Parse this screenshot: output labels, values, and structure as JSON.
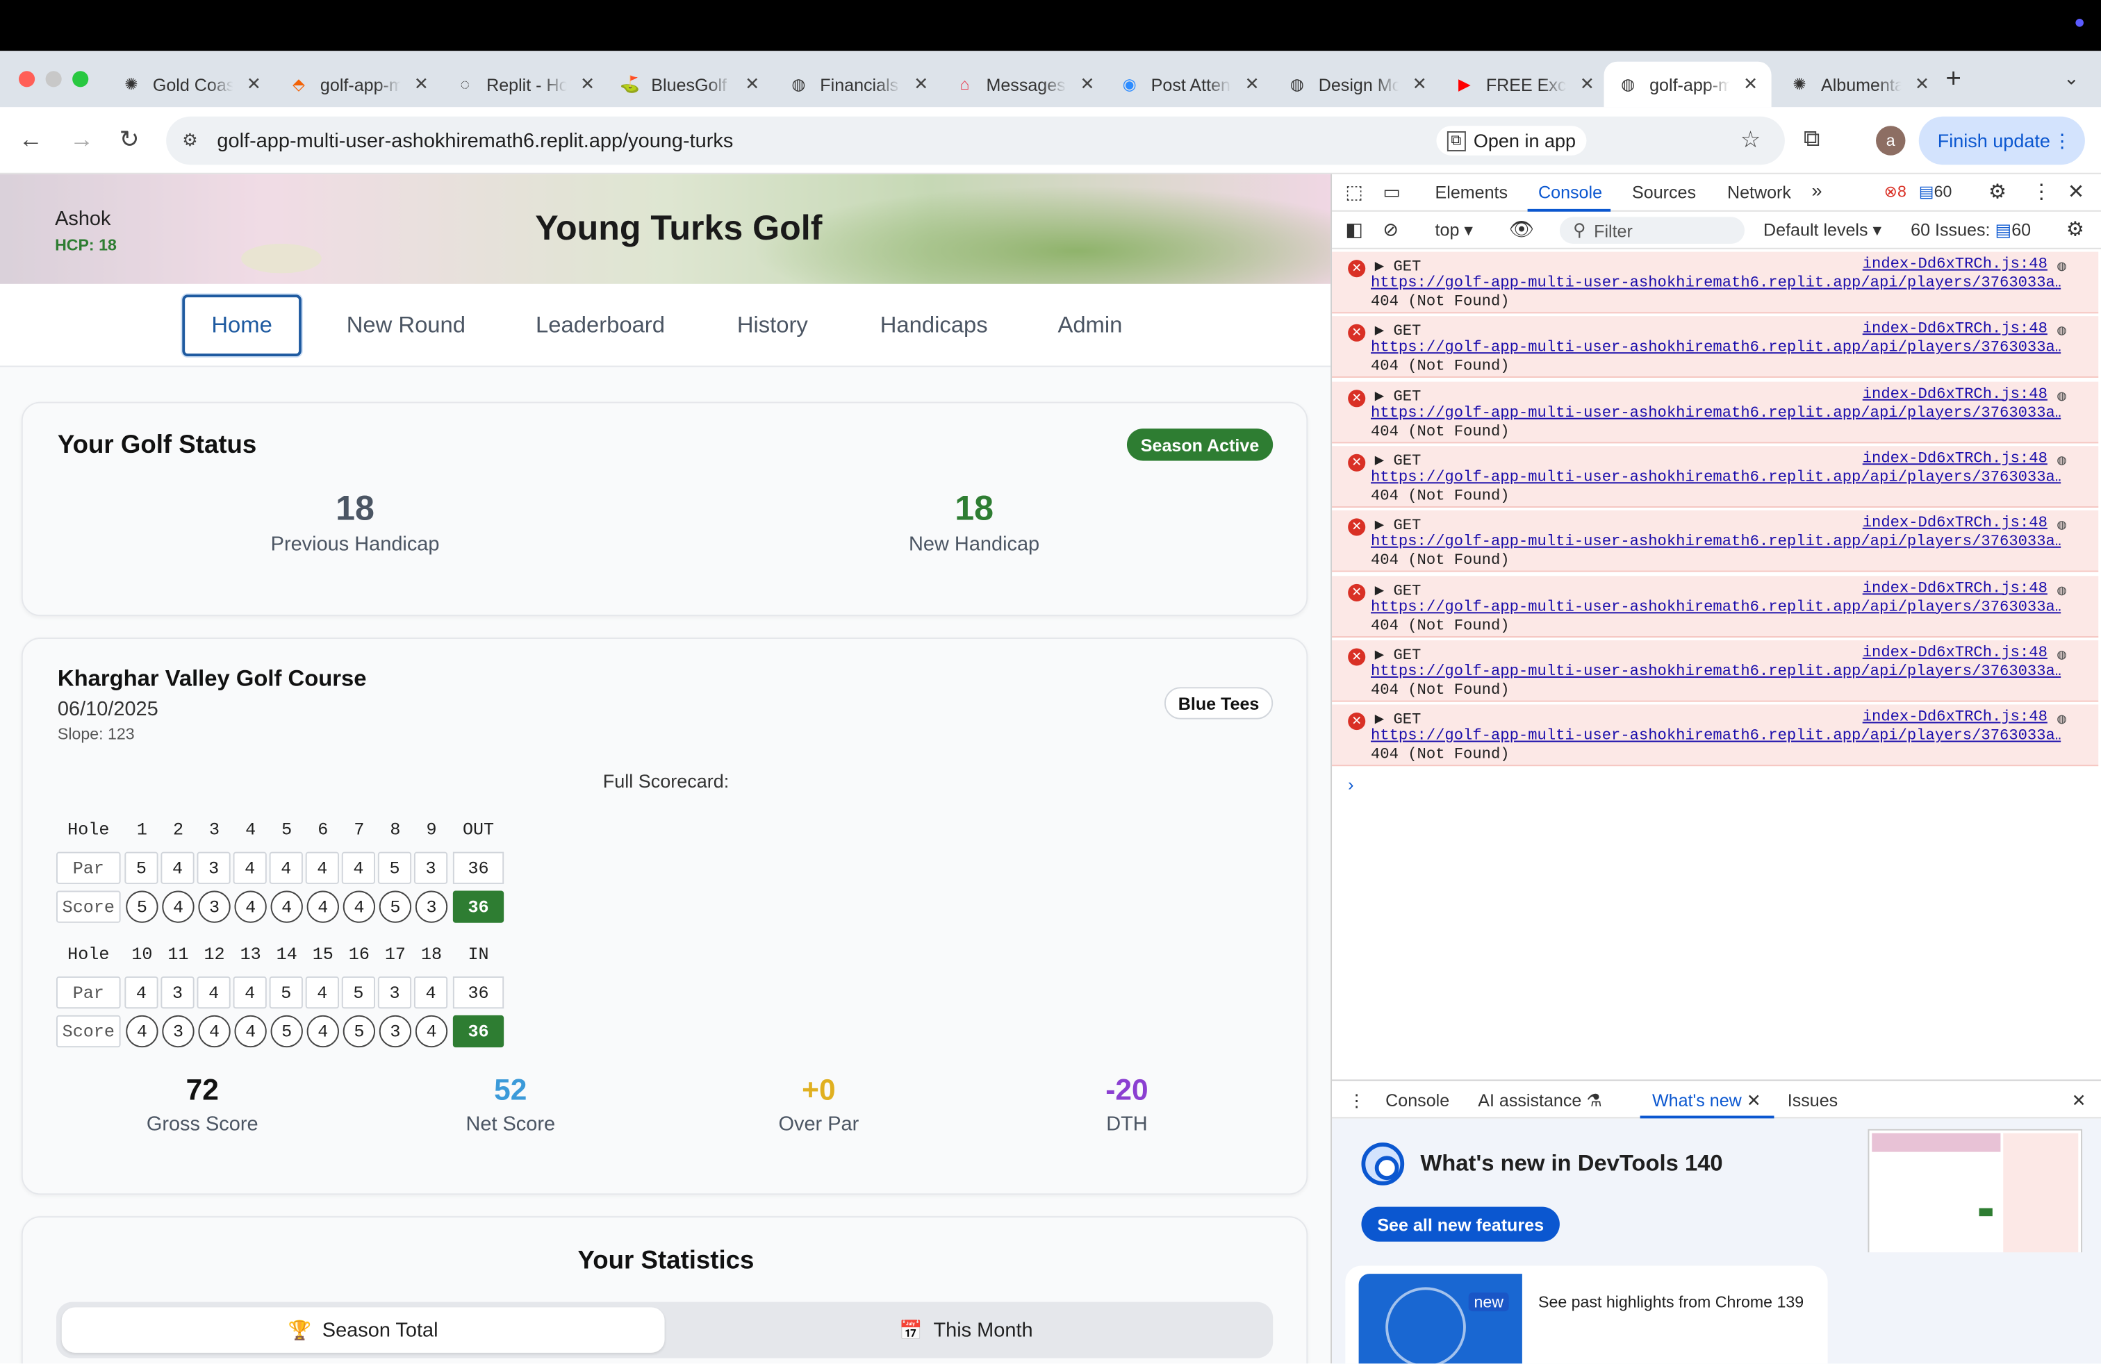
{
  "browser": {
    "tabs": [
      {
        "title": "Gold Coast",
        "icon": "openai-icon"
      },
      {
        "title": "golf-app-multi",
        "icon": "replit-icon"
      },
      {
        "title": "Replit - Home",
        "icon": "loading-icon"
      },
      {
        "title": "BluesGolf",
        "icon": "bluesgolf-icon"
      },
      {
        "title": "Financials",
        "icon": "globe-icon"
      },
      {
        "title": "Messages",
        "icon": "airbnb-icon"
      },
      {
        "title": "Post Attendee",
        "icon": "zoom-icon"
      },
      {
        "title": "Design Mode",
        "icon": "globe-icon"
      },
      {
        "title": "FREE Excel",
        "icon": "youtube-icon"
      },
      {
        "title": "golf-app-multi",
        "icon": "globe-icon",
        "active": true
      },
      {
        "title": "Albumentations",
        "icon": "openai-icon"
      }
    ],
    "url": "golf-app-multi-user-ashokhiremath6.replit.app/young-turks",
    "open_in_app": "Open in app",
    "finish_update": "Finish update",
    "profile_initial": "a"
  },
  "app": {
    "user_name": "Ashok",
    "user_hcp": "HCP: 18",
    "brand": "Young Turks Golf",
    "nav": [
      "Home",
      "New Round",
      "Leaderboard",
      "History",
      "Handicaps",
      "Admin"
    ],
    "status_card": {
      "title": "Your Golf Status",
      "badge": "Season Active",
      "prev_value": "18",
      "prev_label": "Previous Handicap",
      "new_value": "18",
      "new_label": "New Handicap"
    },
    "round_card": {
      "course": "Kharghar Valley Golf Course",
      "date": "06/10/2025",
      "slope": "Slope: 123",
      "tees": "Blue Tees",
      "scorecard_title": "Full Scorecard:",
      "front": {
        "hole_label": "Hole",
        "holes": [
          "1",
          "2",
          "3",
          "4",
          "5",
          "6",
          "7",
          "8",
          "9"
        ],
        "total_label": "OUT",
        "par_label": "Par",
        "par": [
          "5",
          "4",
          "3",
          "4",
          "4",
          "4",
          "4",
          "5",
          "3"
        ],
        "par_total": "36",
        "score_label": "Score",
        "score": [
          "5",
          "4",
          "3",
          "4",
          "4",
          "4",
          "4",
          "5",
          "3"
        ],
        "score_total": "36"
      },
      "back": {
        "hole_label": "Hole",
        "holes": [
          "10",
          "11",
          "12",
          "13",
          "14",
          "15",
          "16",
          "17",
          "18"
        ],
        "total_label": "IN",
        "par_label": "Par",
        "par": [
          "4",
          "3",
          "4",
          "4",
          "5",
          "4",
          "5",
          "3",
          "4"
        ],
        "par_total": "36",
        "score_label": "Score",
        "score": [
          "4",
          "3",
          "4",
          "4",
          "5",
          "4",
          "5",
          "3",
          "4"
        ],
        "score_total": "36"
      },
      "summary": [
        {
          "value": "72",
          "label": "Gross Score",
          "color": "#111111"
        },
        {
          "value": "52",
          "label": "Net Score",
          "color": "#3b9ad9"
        },
        {
          "value": "+0",
          "label": "Over Par",
          "color": "#e0b020"
        },
        {
          "value": "-20",
          "label": "DTH",
          "color": "#8b3fd1"
        }
      ]
    },
    "stats_card": {
      "title": "Your Statistics",
      "toggle_season": "Season Total",
      "toggle_month": "This Month"
    }
  },
  "devtools": {
    "tabs": [
      "Elements",
      "Console",
      "Sources",
      "Network"
    ],
    "error_count": "8",
    "message_count": "60",
    "context": "top",
    "filter_placeholder": "Filter",
    "levels": "Default levels",
    "issues_label": "60 Issues:",
    "issues_count": "60",
    "logs": [
      {
        "method": "GET",
        "source": "index-Dd6xTRCh.js:48",
        "url": "https://golf-app-multi-user-ashokhiremath6.replit.app/api/players/3763033a…",
        "status": "404 (Not Found)"
      },
      {
        "method": "GET",
        "source": "index-Dd6xTRCh.js:48",
        "url": "https://golf-app-multi-user-ashokhiremath6.replit.app/api/players/3763033a…",
        "status": "404 (Not Found)"
      },
      {
        "method": "GET",
        "source": "index-Dd6xTRCh.js:48",
        "url": "https://golf-app-multi-user-ashokhiremath6.replit.app/api/players/3763033a…",
        "status": "404 (Not Found)"
      },
      {
        "method": "GET",
        "source": "index-Dd6xTRCh.js:48",
        "url": "https://golf-app-multi-user-ashokhiremath6.replit.app/api/players/3763033a…",
        "status": "404 (Not Found)"
      },
      {
        "method": "GET",
        "source": "index-Dd6xTRCh.js:48",
        "url": "https://golf-app-multi-user-ashokhiremath6.replit.app/api/players/3763033a…",
        "status": "404 (Not Found)"
      },
      {
        "method": "GET",
        "source": "index-Dd6xTRCh.js:48",
        "url": "https://golf-app-multi-user-ashokhiremath6.replit.app/api/players/3763033a…",
        "status": "404 (Not Found)"
      },
      {
        "method": "GET",
        "source": "index-Dd6xTRCh.js:48",
        "url": "https://golf-app-multi-user-ashokhiremath6.replit.app/api/players/3763033a…",
        "status": "404 (Not Found)"
      },
      {
        "method": "GET",
        "source": "index-Dd6xTRCh.js:48",
        "url": "https://golf-app-multi-user-ashokhiremath6.replit.app/api/players/3763033a…",
        "status": "404 (Not Found)"
      }
    ],
    "drawer_tabs": [
      "Console",
      "AI assistance",
      "What's new",
      "Issues"
    ],
    "whats_new_title": "What's new in DevTools 140",
    "see_all": "See all new features",
    "new_badge": "new",
    "past_highlights": "See past highlights from Chrome 139"
  }
}
